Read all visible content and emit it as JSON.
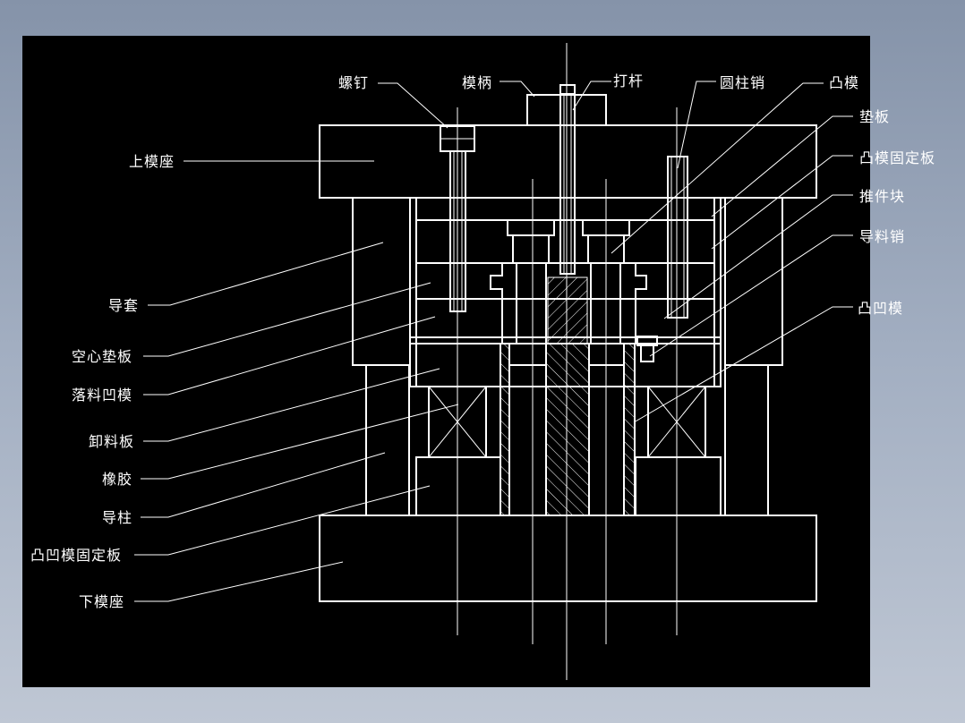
{
  "labels": {
    "screw": "螺钉",
    "die_shank": "模柄",
    "knockout_rod": "打杆",
    "dowel_pin": "圆柱销",
    "punch": "凸模",
    "backing_plate": "垫板",
    "punch_retainer": "凸模固定板",
    "ejector_block": "推件块",
    "guide_pin": "导料销",
    "punch_die": "凸凹模",
    "upper_die_base": "上模座",
    "guide_sleeve": "导套",
    "hollow_spacer": "空心垫板",
    "blanking_die": "落料凹模",
    "stripper_plate": "卸料板",
    "rubber": "橡胶",
    "guide_post": "导柱",
    "punch_die_retainer": "凸凹模固定板",
    "lower_die_base": "下模座"
  },
  "colors": {
    "background": "#000000",
    "lines": "#ffffff",
    "desktop_top": "#8593a9",
    "desktop_bottom": "#bfc7d4"
  }
}
